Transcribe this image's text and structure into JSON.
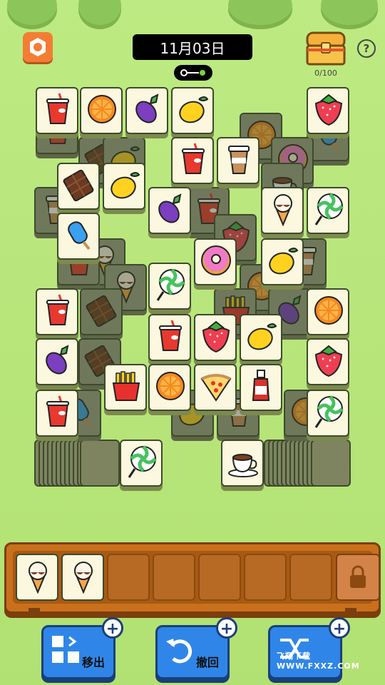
{
  "header": {
    "date": "11月03日",
    "chest_count": "0/100",
    "help_label": "?"
  },
  "board": {
    "layers": "tile-matching board with stacked item tiles",
    "items": {
      "drink": "red-drink-icon",
      "orange": "orange-slice-icon",
      "eggplant": "eggplant-icon",
      "lemon": "lemon-icon",
      "strawberry": "strawberry-icon",
      "chocolate": "chocolate-bar-icon",
      "coffee": "iced-coffee-icon",
      "icecream": "ice-cream-cone-icon",
      "lollipop": "lollipop-icon",
      "popsicle": "popsicle-icon",
      "donut": "donut-icon",
      "fries": "fries-icon",
      "pizza": "pizza-slice-icon",
      "ketchup": "ketchup-icon",
      "teacup": "coffee-cup-icon"
    }
  },
  "tray": {
    "slots_filled": [
      "ice-cream-cone-icon",
      "ice-cream-cone-icon"
    ],
    "slot_count": 7
  },
  "tools": [
    {
      "label": "移出",
      "icon": "move-out-icon"
    },
    {
      "label": "撤回",
      "icon": "undo-icon"
    },
    {
      "label": "",
      "icon": "shuffle-icon"
    }
  ],
  "watermark": "飞翔下载 WWW.FXXZ.COM"
}
